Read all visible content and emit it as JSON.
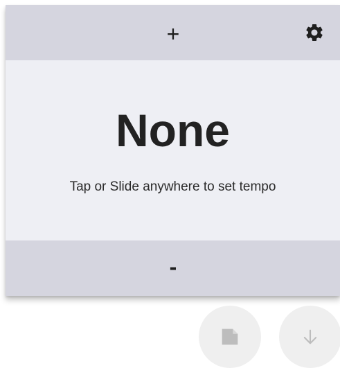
{
  "colors": {
    "bar_background": "#d5d5df",
    "center_background": "#eeeff4",
    "text": "#222222",
    "fab_background": "#efefef",
    "fab_icon": "#bdbdbd"
  },
  "top_bar": {
    "increase_label": "+",
    "settings_icon": "gear-icon"
  },
  "tempo": {
    "value": "None",
    "hint": "Tap or Slide anywhere to set tempo"
  },
  "bottom_bar": {
    "decrease_label": "-"
  },
  "fabs": [
    {
      "icon": "note-icon"
    },
    {
      "icon": "arrow-down-icon"
    }
  ]
}
